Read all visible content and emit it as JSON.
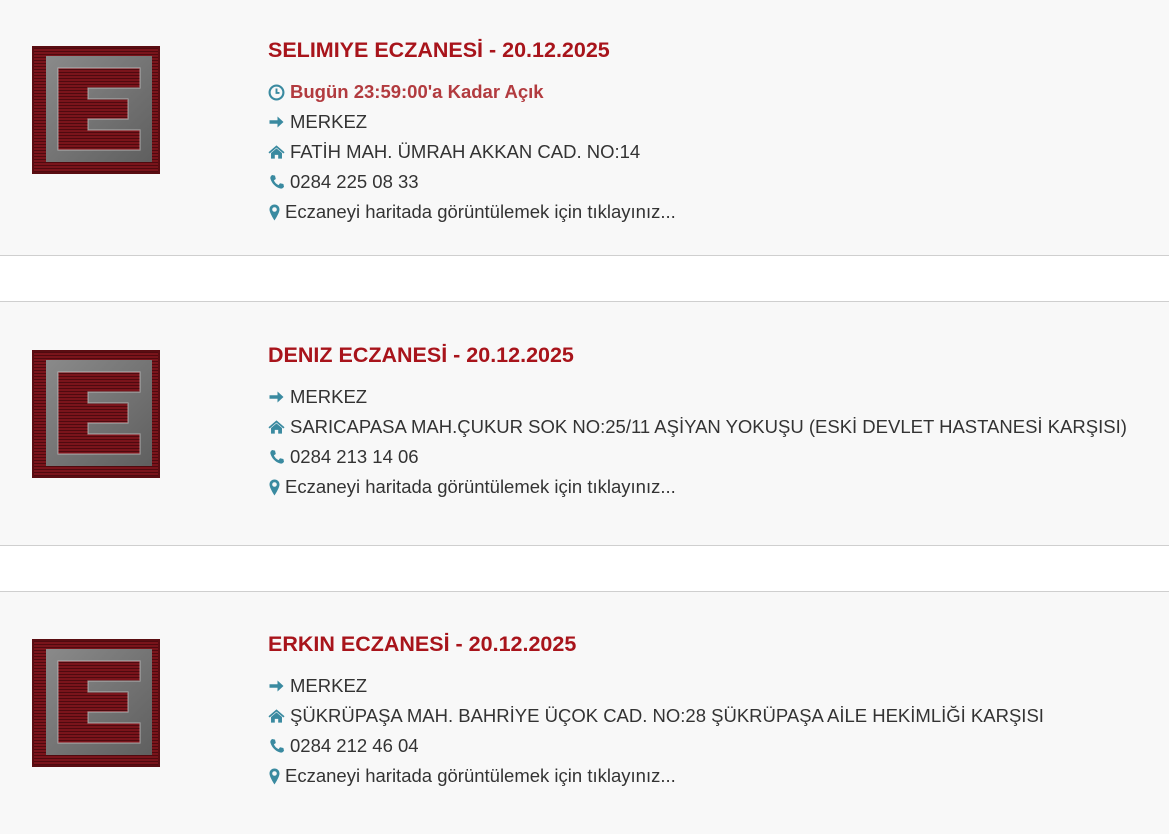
{
  "colors": {
    "title": "#a8141b",
    "open_status": "#b23b3f",
    "icon": "#3a8aa0",
    "card_bg": "#f8f8f8",
    "logo_red": "#7a141b",
    "logo_gray": "#7d7d7d"
  },
  "logo_letter": "E",
  "pharmacies": [
    {
      "title": "SELIMIYE ECZANESİ - 20.12.2025",
      "open_status": "Bugün 23:59:00'a Kadar Açık",
      "district": "MERKEZ",
      "address": "FATİH MAH. ÜMRAH AKKAN CAD. NO:14",
      "phone": "0284 225 08 33",
      "map_link": "Eczaneyi haritada görüntülemek için tıklayınız..."
    },
    {
      "title": "DENIZ ECZANESİ - 20.12.2025",
      "district": "MERKEZ",
      "address": "SARICAPASA MAH.ÇUKUR SOK NO:25/11 AŞİYAN YOKUŞU (ESKİ DEVLET HASTANESİ KARŞISI)",
      "phone": "0284 213 14 06",
      "map_link": "Eczaneyi haritada görüntülemek için tıklayınız..."
    },
    {
      "title": "ERKIN ECZANESİ - 20.12.2025",
      "district": "MERKEZ",
      "address": "ŞÜKRÜPAŞA MAH. BAHRİYE ÜÇOK CAD. NO:28 ŞÜKRÜPAŞA AİLE HEKİMLİĞİ KARŞISI",
      "phone": "0284 212 46 04",
      "map_link": "Eczaneyi haritada görüntülemek için tıklayınız..."
    }
  ],
  "icons": {
    "open_status": "clock-icon",
    "district": "arrow-right-icon",
    "address": "home-icon",
    "phone": "phone-icon",
    "map_link": "map-marker-icon"
  }
}
